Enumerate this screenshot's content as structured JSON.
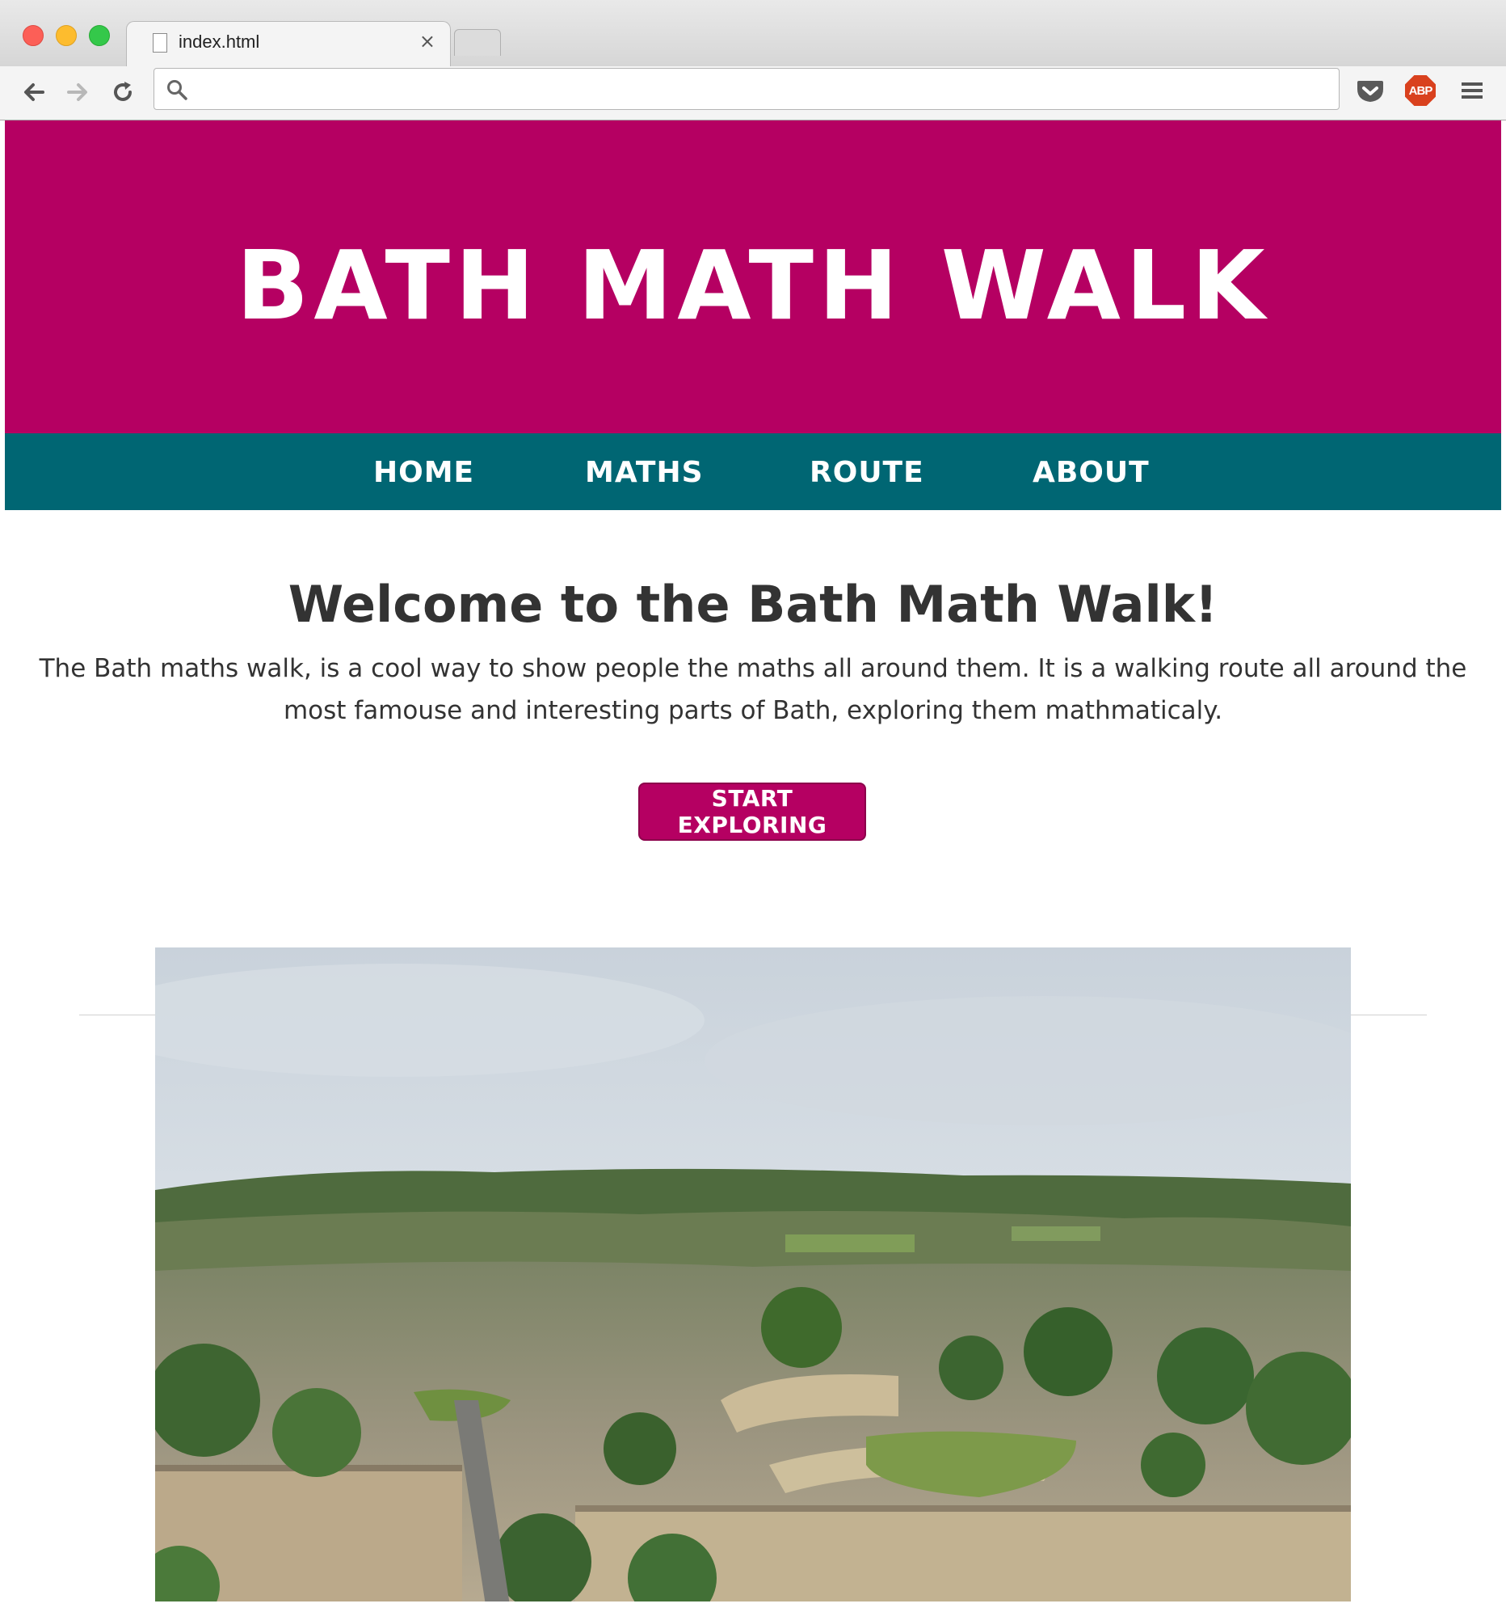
{
  "browser": {
    "tab_title": "index.html",
    "tab_close": "×",
    "address_value": "",
    "extensions": {
      "adblock_label": "ABP"
    },
    "icons": [
      "back-icon",
      "forward-icon",
      "reload-icon",
      "search-icon",
      "pocket-icon",
      "adblock-icon",
      "menu-icon"
    ]
  },
  "site": {
    "title": "BATH MATH WALK",
    "nav": [
      {
        "label": "HOME"
      },
      {
        "label": "MATHS"
      },
      {
        "label": "ROUTE"
      },
      {
        "label": "ABOUT"
      }
    ],
    "heading": "Welcome to the Bath Math Walk!",
    "intro": "The Bath maths walk, is a cool way to show people the maths all around them. It is a walking route all around the most famouse and interesting parts of Bath, exploring them mathmaticaly.",
    "cta_label": "START EXPLORING"
  },
  "colors": {
    "brand": "#b50062",
    "nav": "#006673",
    "text": "#333333"
  }
}
